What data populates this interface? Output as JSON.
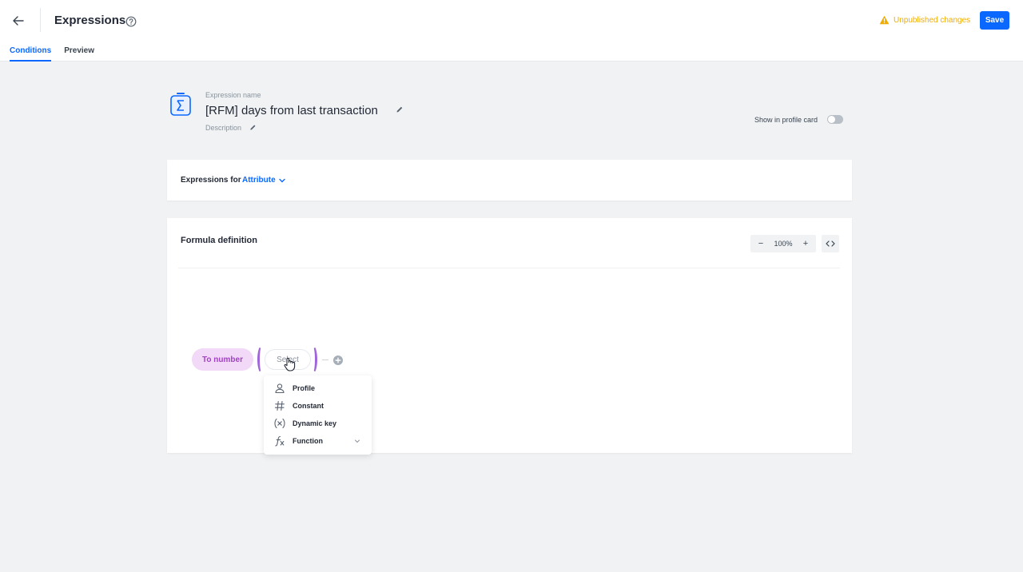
{
  "header": {
    "title": "Expressions",
    "status": "Unpublished changes",
    "save_label": "Save",
    "tabs": [
      {
        "label": "Conditions",
        "active": true
      },
      {
        "label": "Preview",
        "active": false
      }
    ]
  },
  "expression": {
    "name_label": "Expression name",
    "name": "[RFM] days from last transaction",
    "description_label": "Description",
    "show_in_profile_label": "Show in profile card",
    "show_in_profile": false
  },
  "expressions_for": {
    "label": "Expressions for",
    "value": "Attribute"
  },
  "formula": {
    "title": "Formula definition",
    "zoom": "100%",
    "function_name": "To number",
    "argument_placeholder": "Select"
  },
  "dropdown": {
    "items": [
      {
        "label": "Profile",
        "icon": "person-icon"
      },
      {
        "label": "Constant",
        "icon": "hash-icon"
      },
      {
        "label": "Dynamic key",
        "icon": "variable-icon"
      },
      {
        "label": "Function",
        "icon": "function-icon"
      }
    ]
  },
  "colors": {
    "accent": "#0b68ff",
    "warning": "#f0ad00",
    "function_pill_bg": "#f1d9f7",
    "function_pill_text": "#a242c4",
    "paren": "#a065d8"
  }
}
